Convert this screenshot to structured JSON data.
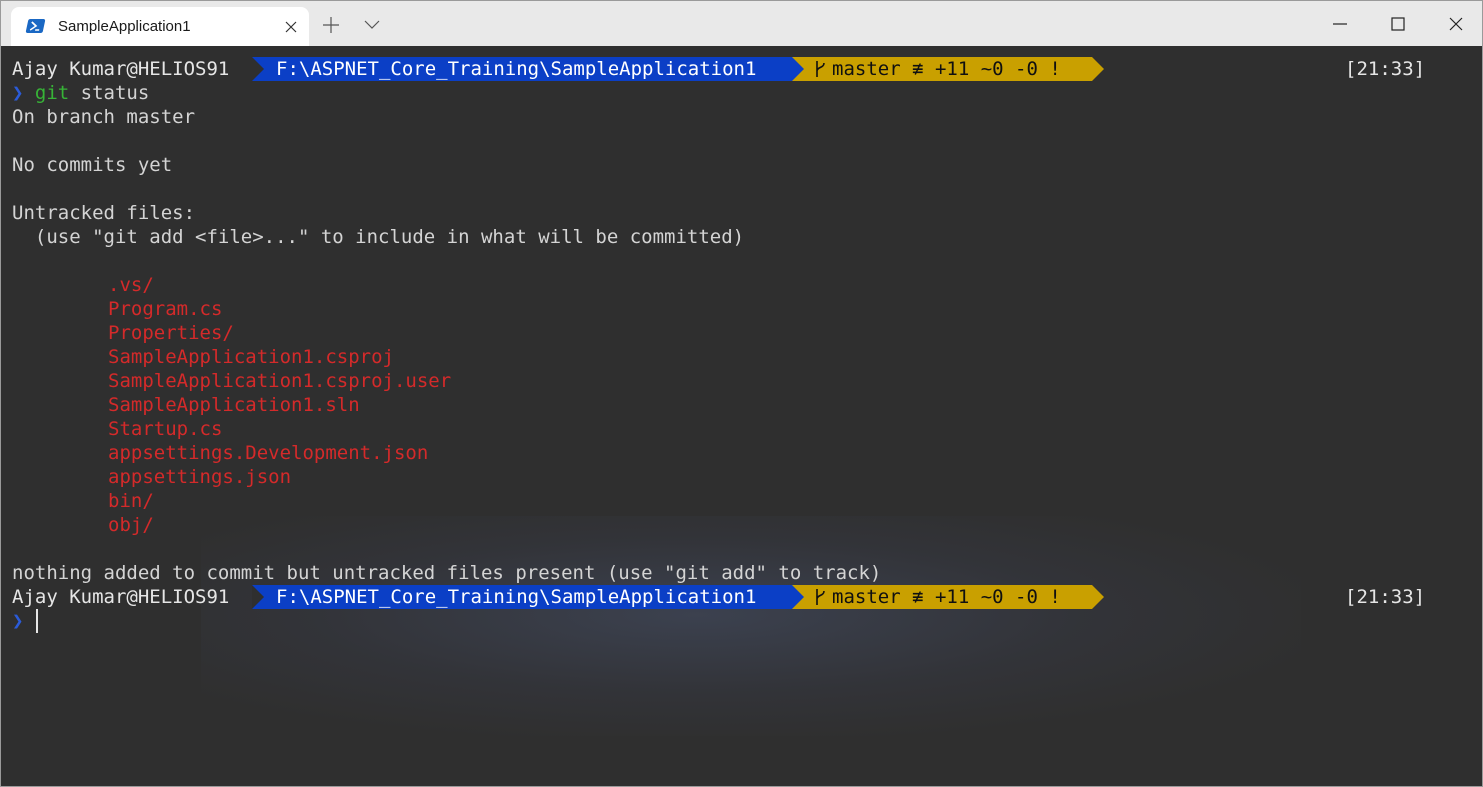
{
  "window": {
    "tab_title": "SampleApplication1",
    "icons": {
      "tab": "powershell-icon",
      "close_tab": "close-icon",
      "new_tab": "plus-icon",
      "dropdown": "chevron-down-icon",
      "minimize": "minimize-icon",
      "maximize": "maximize-icon",
      "close": "close-icon"
    }
  },
  "colors": {
    "terminal_bg": "#2f2f2f",
    "path_segment": "#0b3fc6",
    "git_segment": "#c9a000",
    "untracked_file": "#d42a2a",
    "command": "#37b437",
    "prompt_chevron": "#2b5bd8"
  },
  "prompt": {
    "user": "Ajay Kumar@HELIOS91",
    "path": "F:\\ASPNET_Core_Training\\SampleApplication1",
    "git_status": "master ≢ +11 ~0 -0 !",
    "time": "[21:33]",
    "chevron": "❯"
  },
  "command": {
    "name": "git",
    "args": " status"
  },
  "output": {
    "branch_line": "On branch master",
    "no_commits": "No commits yet",
    "untracked_header": "Untracked files:",
    "hint": "  (use \"git add <file>...\" to include in what will be committed)",
    "files": [
      ".vs/",
      "Program.cs",
      "Properties/",
      "SampleApplication1.csproj",
      "SampleApplication1.csproj.user",
      "SampleApplication1.sln",
      "Startup.cs",
      "appsettings.Development.json",
      "appsettings.json",
      "bin/",
      "obj/"
    ],
    "summary": "nothing added to commit but untracked files present (use \"git add\" to track)"
  }
}
